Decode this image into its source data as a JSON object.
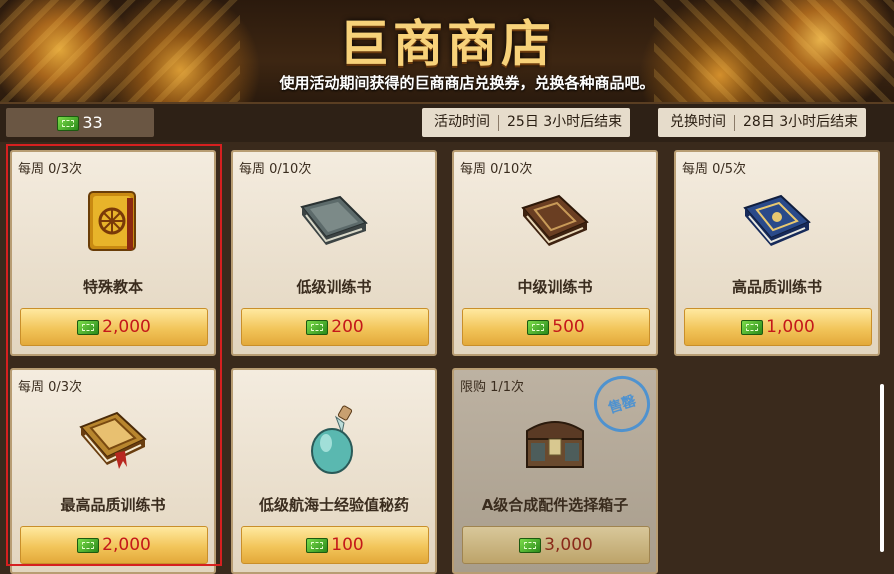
{
  "header": {
    "title": "巨商商店",
    "subtitle": "使用活动期间获得的巨商商店兑换券，兑换各种商品吧。"
  },
  "infobar": {
    "currency_amount": "33",
    "event_time_label": "活动时间",
    "event_time_value": "25日 3小时后结束",
    "exchange_time_label": "兑换时间",
    "exchange_time_value": "28日 3小时后结束"
  },
  "items": [
    {
      "limit": "每周 0/3次",
      "name": "特殊教本",
      "price": "2,000",
      "icon": "golden-book-icon"
    },
    {
      "limit": "每周 0/10次",
      "name": "低级训练书",
      "price": "200",
      "icon": "gray-book-icon"
    },
    {
      "limit": "每周 0/10次",
      "name": "中级训练书",
      "price": "500",
      "icon": "brown-book-icon"
    },
    {
      "limit": "每周 0/5次",
      "name": "高品质训练书",
      "price": "1,000",
      "icon": "blue-book-icon"
    },
    {
      "limit": "每周 0/3次",
      "name": "最高品质训练书",
      "price": "2,000",
      "icon": "ornate-book-icon"
    },
    {
      "limit": "",
      "name": "低级航海士经验值秘药",
      "price": "100",
      "icon": "potion-flask-icon"
    },
    {
      "limit": "限购 1/1次",
      "name": "A级合成配件选择箱子",
      "price": "3,000",
      "icon": "treasure-chest-icon",
      "stamp": "售罄"
    }
  ],
  "colors": {
    "price_text": "#c4181a",
    "selection_border": "#d62020",
    "stamp": "#3d8ed8"
  }
}
